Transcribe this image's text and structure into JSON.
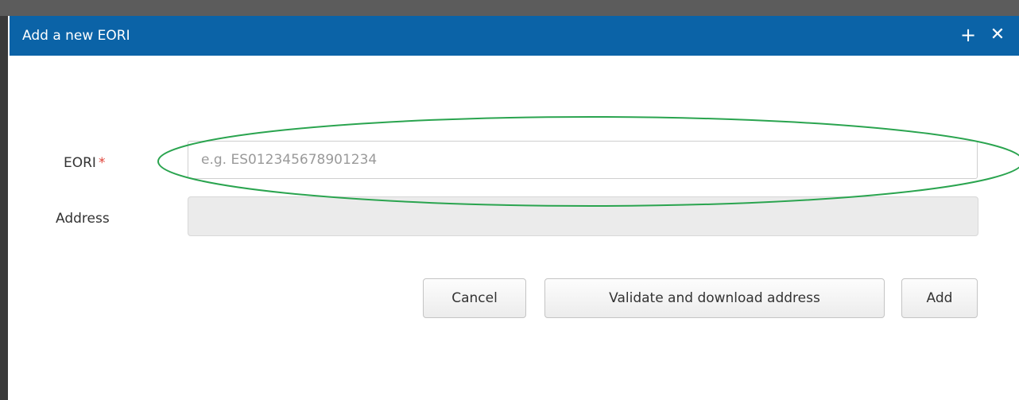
{
  "dialog": {
    "title": "Add a new EORI",
    "controls": {
      "expand_icon": "plus-icon",
      "close_icon": "close-icon",
      "expand_glyph": "+",
      "close_glyph": "✕"
    }
  },
  "form": {
    "eori": {
      "label": "EORI",
      "required_marker": "*",
      "value": "",
      "placeholder": "e.g. ES012345678901234"
    },
    "address": {
      "label": "Address",
      "value": ""
    }
  },
  "buttons": {
    "cancel": "Cancel",
    "validate": "Validate and download address",
    "add": "Add"
  },
  "colors": {
    "titlebar": "#0b63a7",
    "required_marker": "#e0433a",
    "highlight_ellipse": "#2aa44f"
  }
}
